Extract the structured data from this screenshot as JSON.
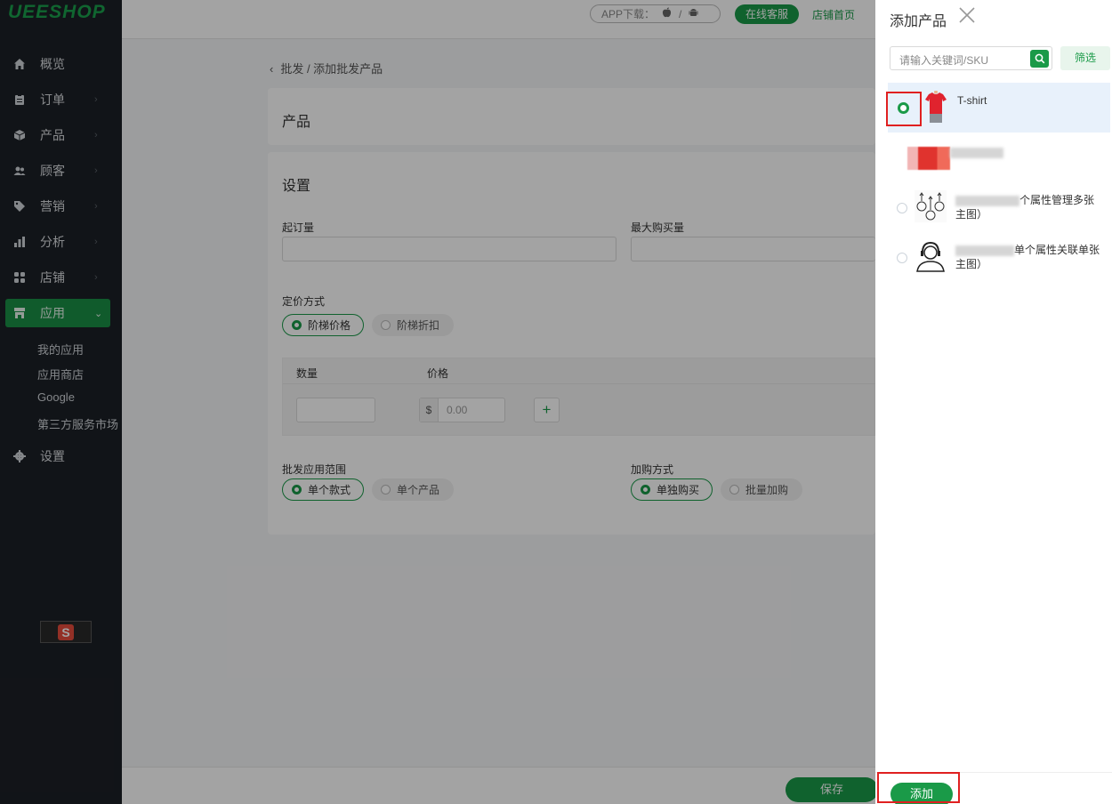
{
  "brand": {
    "logo": "UEESHOP"
  },
  "sidebar": {
    "items": [
      {
        "label": "概览",
        "icon": "home-icon"
      },
      {
        "label": "订单",
        "icon": "clipboard-icon"
      },
      {
        "label": "产品",
        "icon": "box-icon"
      },
      {
        "label": "顾客",
        "icon": "users-icon"
      },
      {
        "label": "营销",
        "icon": "tag-icon"
      },
      {
        "label": "分析",
        "icon": "bar-chart-icon"
      },
      {
        "label": "店铺",
        "icon": "grid-icon"
      },
      {
        "label": "应用",
        "icon": "store-icon"
      },
      {
        "label": "设置",
        "icon": "gear-icon"
      }
    ],
    "sub_items": [
      "我的应用",
      "应用商店",
      "Google",
      "第三方服务市场"
    ]
  },
  "topbar": {
    "app_download": "APP下载：",
    "app_sep": "/",
    "online_service": "在线客服",
    "shop_home": "店铺首页"
  },
  "breadcrumb": "批发 / 添加批发产品",
  "product_card": {
    "title": "产品"
  },
  "settings_card": {
    "title": "设置",
    "min_order_label": "起订量",
    "max_purchase_label": "最大购买量",
    "pricing_label": "定价方式",
    "pricing_options": [
      "阶梯价格",
      "阶梯折扣"
    ],
    "table_headers": {
      "qty": "数量",
      "price": "价格"
    },
    "currency": "$",
    "price_placeholder": "0.00",
    "plus": "+",
    "scope_label": "批发应用范围",
    "scope_options": [
      "单个款式",
      "单个产品"
    ],
    "purchase_label": "加购方式",
    "purchase_options": [
      "单独购买",
      "批量加购"
    ]
  },
  "footer": {
    "save": "保存"
  },
  "panel": {
    "title": "添加产品",
    "search_placeholder": "请输入关键词/SKU",
    "filter": "筛选",
    "products": [
      {
        "name": "T-shirt",
        "selected": true
      },
      {
        "name": "",
        "selected": false
      },
      {
        "name_tail": "个属性管理多张",
        "name_line2": "主图）",
        "selected": false
      },
      {
        "name_tail": "单个属性关联单张",
        "name_line2": "主图）",
        "selected": false
      }
    ],
    "add_button": "添加"
  },
  "colors": {
    "accent": "#1a9a48",
    "sidebar_bg": "#1c2026",
    "highlight": "#e02020"
  }
}
